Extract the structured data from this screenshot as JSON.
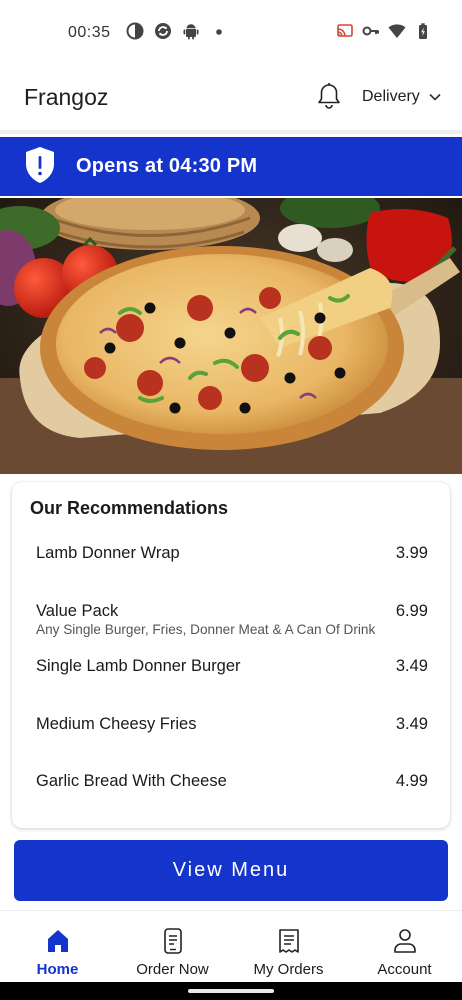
{
  "status_bar": {
    "time": "00:35",
    "left_icons": [
      "data-saver-icon",
      "sync-icon",
      "android-icon",
      "dot-icon"
    ],
    "right_icons": [
      "cast-icon",
      "vpn-key-icon",
      "wifi-icon",
      "battery-icon"
    ]
  },
  "header": {
    "title": "Frangoz",
    "notification_icon": "bell-icon",
    "mode_label": "Delivery",
    "mode_icon": "chevron-down-icon"
  },
  "banner": {
    "icon": "shield-alert-icon",
    "text": "Opens at 04:30 PM",
    "color": "#1434cb"
  },
  "hero": {
    "image": "pizza-photo"
  },
  "recommendations": {
    "title": "Our Recommendations",
    "items": [
      {
        "name": "Lamb Donner Wrap",
        "price": "3.99",
        "description": ""
      },
      {
        "name": "Value Pack",
        "price": "6.99",
        "description": "Any Single Burger, Fries, Donner Meat & A Can Of Drink"
      },
      {
        "name": "Single Lamb Donner Burger",
        "price": "3.49",
        "description": ""
      },
      {
        "name": "Medium Cheesy Fries",
        "price": "3.49",
        "description": ""
      },
      {
        "name": "Garlic Bread With Cheese",
        "price": "4.99",
        "description": ""
      }
    ]
  },
  "cta": {
    "label": "View Menu"
  },
  "bottom_nav": {
    "items": [
      {
        "label": "Home",
        "icon": "home-icon",
        "active": true
      },
      {
        "label": "Order Now",
        "icon": "order-phone-icon",
        "active": false
      },
      {
        "label": "My Orders",
        "icon": "receipt-icon",
        "active": false
      },
      {
        "label": "Account",
        "icon": "account-icon",
        "active": false
      }
    ]
  },
  "colors": {
    "accent": "#1434cb",
    "text": "#1b1b1b",
    "muted": "#555555"
  }
}
